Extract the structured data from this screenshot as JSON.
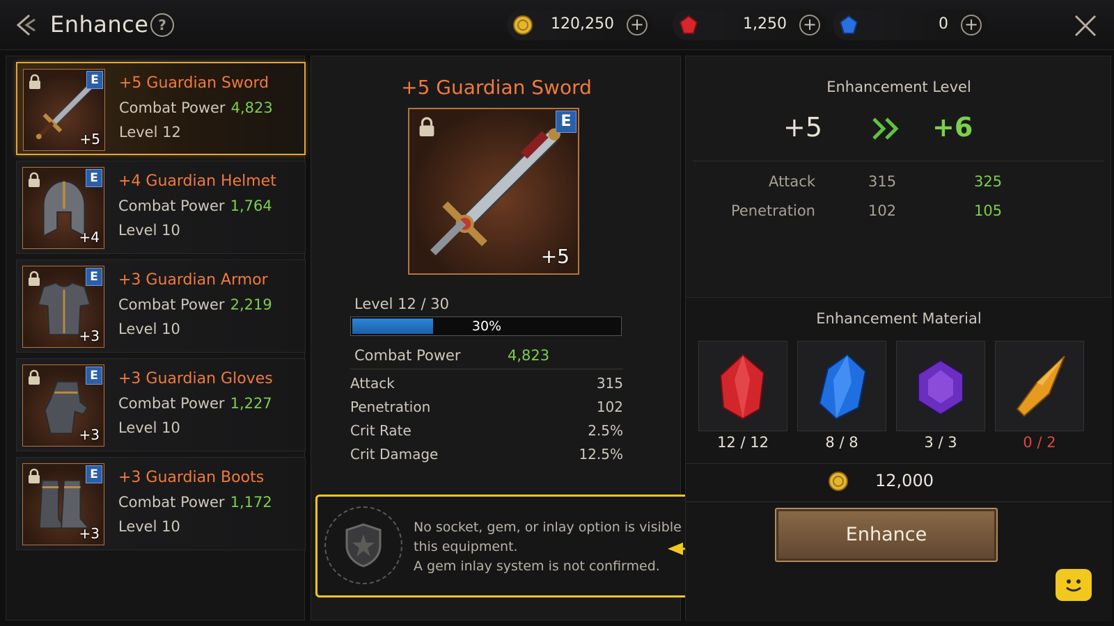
{
  "header": {
    "title": "Enhance",
    "help_label": "?",
    "currencies": [
      {
        "name": "gold",
        "value": "120,250",
        "color": "#e6b52e",
        "icon": "gold-coin-icon"
      },
      {
        "name": "red-gem",
        "value": "1,250",
        "color": "#d6262b",
        "icon": "red-gem-icon"
      },
      {
        "name": "blue-gem",
        "value": "0",
        "color": "#2a6fe0",
        "icon": "blue-gem-icon"
      }
    ],
    "plus_label": "+"
  },
  "equipment": [
    {
      "name": "+5 Guardian Sword",
      "cp_label": "Combat Power",
      "cp": "4,823",
      "level": "Level 12",
      "plus": "+5",
      "grade": "E",
      "selected": true
    },
    {
      "name": "+4 Guardian Helmet",
      "cp_label": "Combat Power",
      "cp": "1,764",
      "level": "Level 10",
      "plus": "+4",
      "grade": "E"
    },
    {
      "name": "+3 Guardian Armor",
      "cp_label": "Combat Power",
      "cp": "2,219",
      "level": "Level 10",
      "plus": "+3",
      "grade": "E"
    },
    {
      "name": "+3 Guardian Gloves",
      "cp_label": "Combat Power",
      "cp": "1,227",
      "level": "Level 10",
      "plus": "+3",
      "grade": "E"
    },
    {
      "name": "+3 Guardian Boots",
      "cp_label": "Combat Power",
      "cp": "1,172",
      "level": "Level 10",
      "plus": "+3",
      "grade": "E"
    }
  ],
  "detail": {
    "name": "+5 Guardian Sword",
    "grade": "E",
    "plus": "+5",
    "level_label": "Level 12 / 30",
    "progress_percent": 30,
    "progress_text": "30%",
    "cp_label": "Combat Power",
    "cp": "4,823",
    "stats": [
      {
        "label": "Attack",
        "value": "315"
      },
      {
        "label": "Penetration",
        "value": "102"
      },
      {
        "label": "Crit Rate",
        "value": "2.5%"
      },
      {
        "label": "Crit Damage",
        "value": "12.5%"
      }
    ],
    "note_line1": "No socket, gem, or inlay option is visible for",
    "note_line2": "this equipment.",
    "note_line3": "A gem inlay system is not confirmed."
  },
  "enhancement": {
    "heading": "Enhancement Level",
    "from": "+5",
    "to": "+6",
    "stats": [
      {
        "label": "Attack",
        "current": "315",
        "next": "325"
      },
      {
        "label": "Penetration",
        "current": "102",
        "next": "105"
      }
    ],
    "material_heading": "Enhancement Material",
    "materials": [
      {
        "name": "red-crystal",
        "count": "12 / 12",
        "sufficient": true
      },
      {
        "name": "blue-crystal",
        "count": "8 / 8",
        "sufficient": true
      },
      {
        "name": "purple-crystal",
        "count": "3 / 3",
        "sufficient": true
      },
      {
        "name": "amber-shard",
        "count": "0 / 2",
        "sufficient": false
      }
    ],
    "cost": "12,000",
    "button_label": "Enhance"
  }
}
